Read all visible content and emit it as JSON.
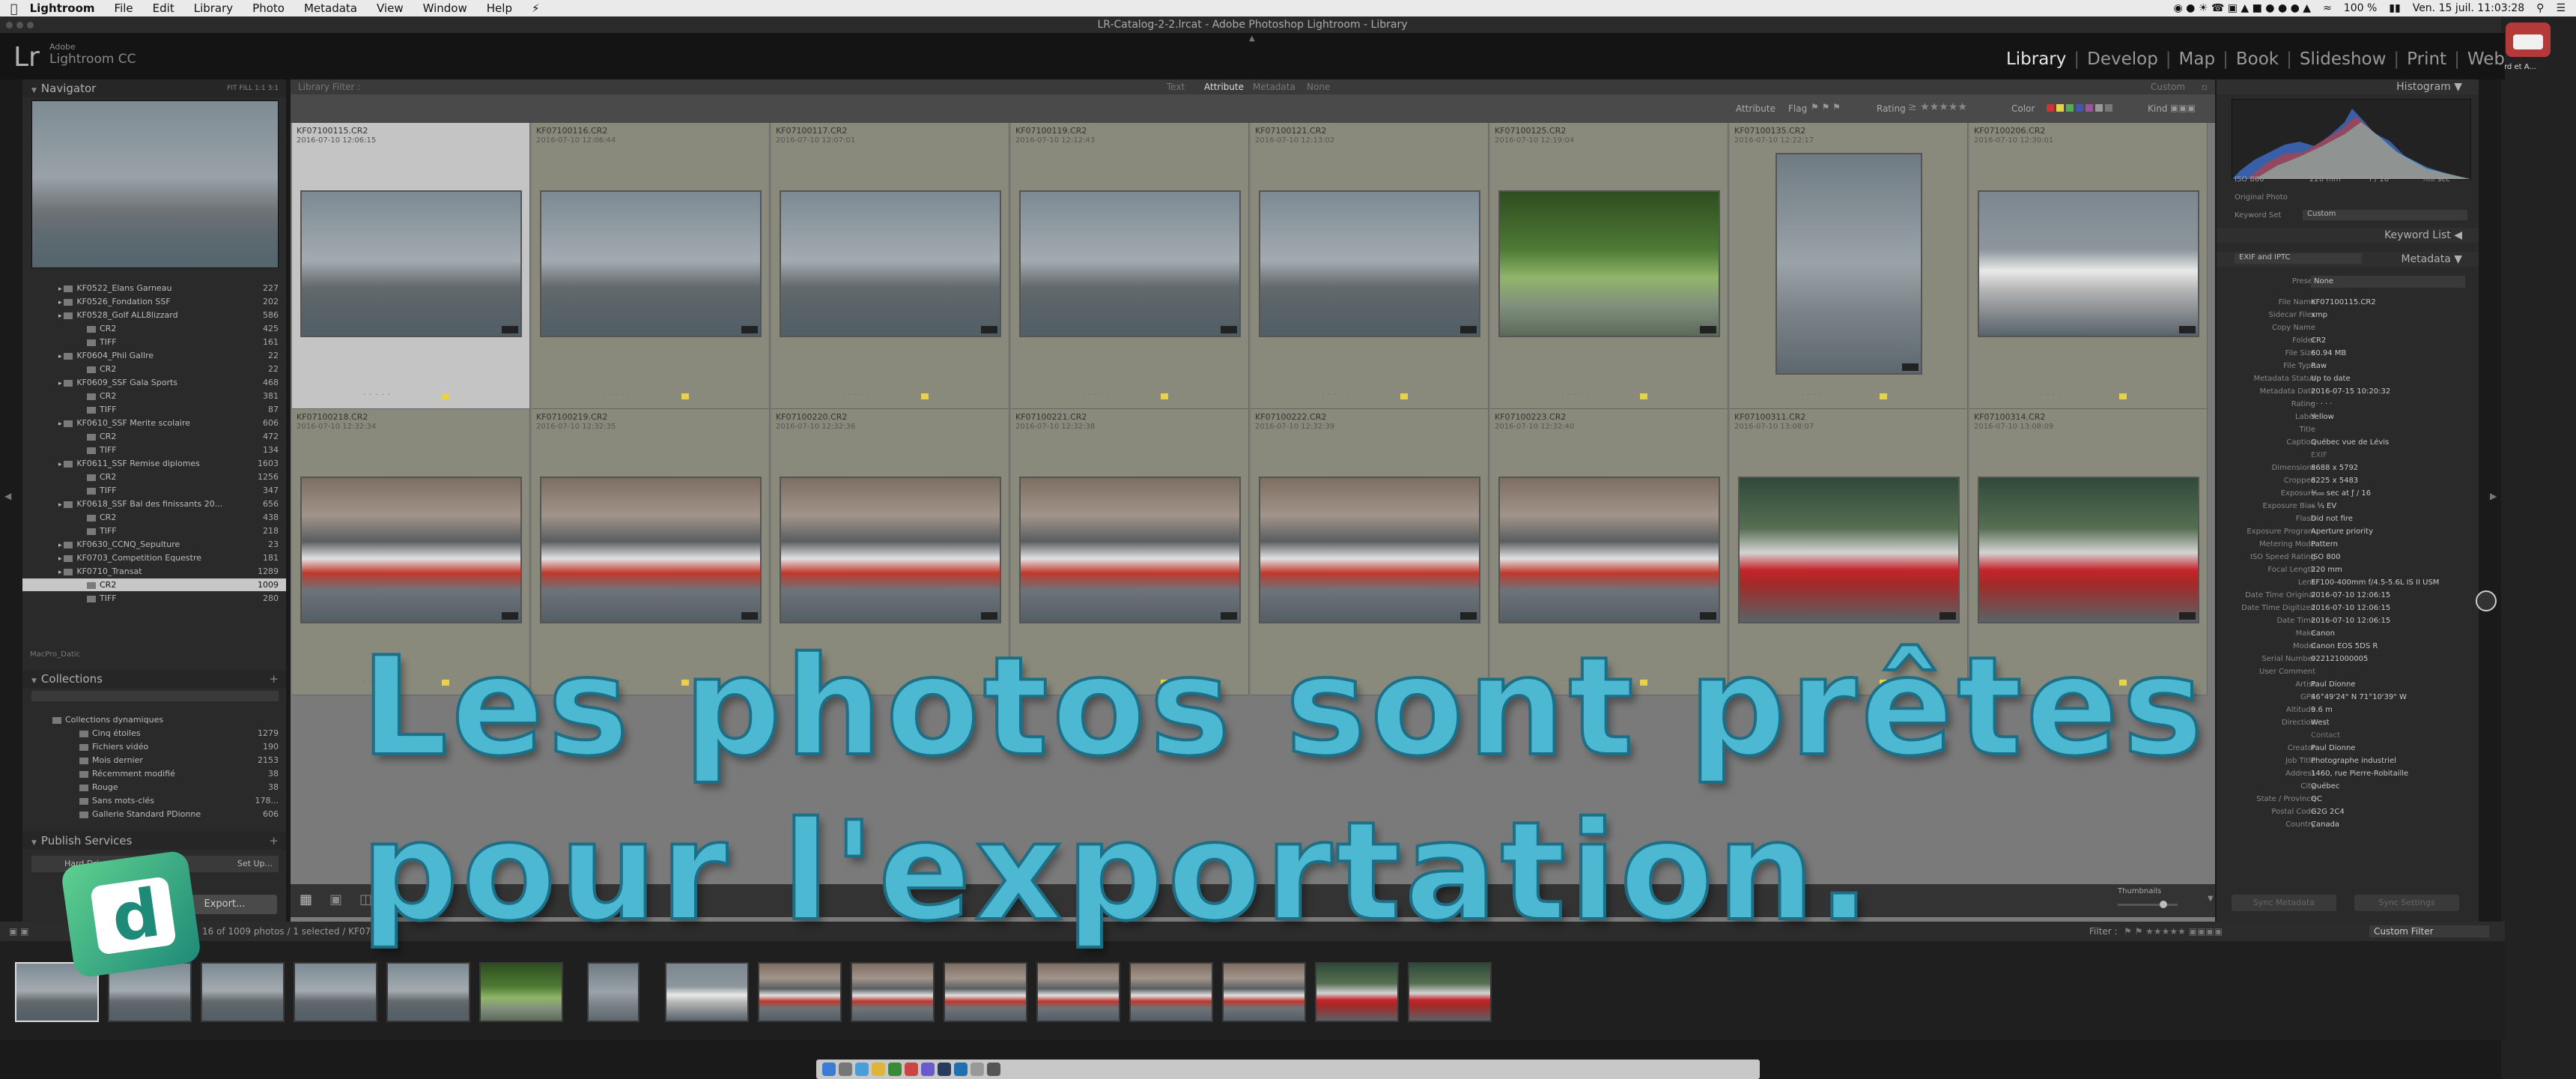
{
  "menubar": {
    "app": "Lightroom",
    "items": [
      "File",
      "Edit",
      "Library",
      "Photo",
      "Metadata",
      "View",
      "Window",
      "Help"
    ],
    "battery": "100 %",
    "clock": "Ven. 15 juil.  11:03:28"
  },
  "window": {
    "title": "LR-Catalog-2-2.lrcat - Adobe Photoshop Lightroom - Library"
  },
  "header": {
    "logo_letters": "Lr",
    "brand_top": "Adobe",
    "brand": "Lightroom CC",
    "modules": [
      "Library",
      "Develop",
      "Map",
      "Book",
      "Slideshow",
      "Print",
      "Web"
    ],
    "active_module": "Library"
  },
  "navigator": {
    "title": "Navigator",
    "zoom": "FIT   FILL   1:1   3:1"
  },
  "folders": [
    {
      "name": "KF0522_Elans Garneau",
      "count": "227",
      "level": 1
    },
    {
      "name": "KF0526_Fondation SSF",
      "count": "202",
      "level": 1
    },
    {
      "name": "KF0528_Golf ALL8lizzard",
      "count": "586",
      "level": 1
    },
    {
      "name": "CR2",
      "count": "425",
      "level": 2
    },
    {
      "name": "TIFF",
      "count": "161",
      "level": 2
    },
    {
      "name": "KF0604_Phil Gallre",
      "count": "22",
      "level": 1
    },
    {
      "name": "CR2",
      "count": "22",
      "level": 2
    },
    {
      "name": "KF0609_SSF Gala Sports",
      "count": "468",
      "level": 1
    },
    {
      "name": "CR2",
      "count": "381",
      "level": 2
    },
    {
      "name": "TIFF",
      "count": "87",
      "level": 2
    },
    {
      "name": "KF0610_SSF Merite scolaire",
      "count": "606",
      "level": 1
    },
    {
      "name": "CR2",
      "count": "472",
      "level": 2
    },
    {
      "name": "TIFF",
      "count": "134",
      "level": 2
    },
    {
      "name": "KF0611_SSF Remise diplomes",
      "count": "1603",
      "level": 1
    },
    {
      "name": "CR2",
      "count": "1256",
      "level": 2
    },
    {
      "name": "TIFF",
      "count": "347",
      "level": 2
    },
    {
      "name": "KF0618_SSF Bal des finissants 20...",
      "count": "656",
      "level": 1
    },
    {
      "name": "CR2",
      "count": "438",
      "level": 2
    },
    {
      "name": "TIFF",
      "count": "218",
      "level": 2
    },
    {
      "name": "KF0630_CCNQ_Sepulture",
      "count": "23",
      "level": 1
    },
    {
      "name": "KF0703_Competition Equestre",
      "count": "181",
      "level": 1
    },
    {
      "name": "KF0710_Transat",
      "count": "1289",
      "level": 1
    },
    {
      "name": "CR2",
      "count": "1009",
      "level": 2,
      "selected": true
    },
    {
      "name": "TIFF",
      "count": "280",
      "level": 2
    }
  ],
  "drive": "MacPro_Datic",
  "collections": {
    "title": "Collections",
    "group": "Collections dynamiques",
    "items": [
      {
        "name": "Cinq étoiles",
        "count": "1279"
      },
      {
        "name": "Fichiers vidéo",
        "count": "190"
      },
      {
        "name": "Mois dernier",
        "count": "2153"
      },
      {
        "name": "Récemment modifié",
        "count": "38"
      },
      {
        "name": "Rouge",
        "count": "38"
      },
      {
        "name": "Sans mots-clés",
        "count": "178..."
      },
      {
        "name": "Gallerie Standard PDionne",
        "count": "606"
      }
    ]
  },
  "publish": {
    "title": "Publish Services",
    "item": "Hard Drive",
    "setup": "Set Up..."
  },
  "buttons": {
    "export": "Export..."
  },
  "filter": {
    "title": "Library Filter :",
    "tabs": [
      "Text",
      "Attribute",
      "Metadata",
      "None"
    ],
    "active_tab": "Attribute",
    "preset": "Custom",
    "attr_label": "Attribute",
    "flag": "Flag",
    "rating": "Rating",
    "color": "Color",
    "kind": "Kind"
  },
  "grid_row1": [
    {
      "file": "KF07100115.CR2",
      "date": "2016-07-10 12:06:15",
      "type": "sky",
      "selected": true
    },
    {
      "file": "KF07100116.CR2",
      "date": "2016-07-10 12:06:44",
      "type": "sky"
    },
    {
      "file": "KF07100117.CR2",
      "date": "2016-07-10 12:07:01",
      "type": "sky"
    },
    {
      "file": "KF07100119.CR2",
      "date": "2016-07-10 12:12:43",
      "type": "sky"
    },
    {
      "file": "KF07100121.CR2",
      "date": "2016-07-10 12:13:02",
      "type": "sky"
    },
    {
      "file": "KF07100125.CR2",
      "date": "2016-07-10 12:19:04",
      "type": "green"
    },
    {
      "file": "KF07100135.CR2",
      "date": "2016-07-10 12:22:17",
      "type": "tower"
    },
    {
      "file": "KF07100206.CR2",
      "date": "2016-07-10 12:30:01",
      "type": "boat"
    }
  ],
  "grid_row2": [
    {
      "file": "KF07100218.CR2",
      "date": "2016-07-10 12:32:34",
      "type": "tug"
    },
    {
      "file": "KF07100219.CR2",
      "date": "2016-07-10 12:32:35",
      "type": "tug"
    },
    {
      "file": "KF07100220.CR2",
      "date": "2016-07-10 12:32:36",
      "type": "tug"
    },
    {
      "file": "KF07100221.CR2",
      "date": "2016-07-10 12:32:38",
      "type": "tug"
    },
    {
      "file": "KF07100222.CR2",
      "date": "2016-07-10 12:32:39",
      "type": "tug"
    },
    {
      "file": "KF07100223.CR2",
      "date": "2016-07-10 12:32:40",
      "type": "tug"
    },
    {
      "file": "KF07100311.CR2",
      "date": "2016-07-10 13:08:07",
      "type": "red"
    },
    {
      "file": "KF07100314.CR2",
      "date": "2016-07-10 13:08:09",
      "type": "red"
    }
  ],
  "histogram": {
    "title": "Histogram",
    "iso": "ISO 800",
    "focal": "220 mm",
    "aperture": "f / 16",
    "shutter": "¹⁄₅₀₀ sec",
    "original": "Original Photo"
  },
  "keyword": {
    "set_label": "Keyword Set",
    "set_value": "Custom",
    "list_title": "Keyword List"
  },
  "metadata": {
    "title": "Metadata",
    "view": "EXIF and IPTC",
    "preset_label": "Preset",
    "preset_value": "None",
    "fields": [
      {
        "k": "File Name",
        "v": "KF07100115.CR2"
      },
      {
        "k": "Sidecar Files",
        "v": "xmp"
      },
      {
        "k": "Copy Name",
        "v": ""
      },
      {
        "k": "Folder",
        "v": "CR2"
      },
      {
        "k": "File Size",
        "v": "60.94 MB"
      },
      {
        "k": "File Type",
        "v": "Raw"
      },
      {
        "k": "Metadata Status",
        "v": "Up to date"
      },
      {
        "k": "Metadata Date",
        "v": "2016-07-15 10:20:32"
      },
      {
        "k": "Rating",
        "v": "·  ·  ·  ·  ·"
      },
      {
        "k": "Label",
        "v": "Yellow"
      },
      {
        "k": "Title",
        "v": ""
      },
      {
        "k": "Caption",
        "v": "Québec vue de Lévis"
      },
      {
        "k": "",
        "v": "EXIF"
      },
      {
        "k": "Dimensions",
        "v": "8688 x 5792"
      },
      {
        "k": "Cropped",
        "v": "8225 x 5483"
      },
      {
        "k": "Exposure",
        "v": "¹⁄₅₀₀ sec at ƒ / 16"
      },
      {
        "k": "Exposure Bias",
        "v": "– ¹⁄₃ EV"
      },
      {
        "k": "Flash",
        "v": "Did not fire"
      },
      {
        "k": "Exposure Program",
        "v": "Aperture priority"
      },
      {
        "k": "Metering Mode",
        "v": "Pattern"
      },
      {
        "k": "ISO Speed Rating",
        "v": "ISO 800"
      },
      {
        "k": "Focal Length",
        "v": "220 mm"
      },
      {
        "k": "Lens",
        "v": "EF100-400mm f/4.5-5.6L IS II USM"
      },
      {
        "k": "Date Time Original",
        "v": "2016-07-10 12:06:15"
      },
      {
        "k": "Date Time Digitized",
        "v": "2016-07-10 12:06:15"
      },
      {
        "k": "Date Time",
        "v": "2016-07-10 12:06:15"
      },
      {
        "k": "Make",
        "v": "Canon"
      },
      {
        "k": "Model",
        "v": "Canon EOS 5DS R"
      },
      {
        "k": "Serial Number",
        "v": "022121000005"
      },
      {
        "k": "User Comment",
        "v": ""
      },
      {
        "k": "Artist",
        "v": "Paul Dionne"
      },
      {
        "k": "GPS",
        "v": "46°49'24\" N 71°10'39\" W"
      },
      {
        "k": "Altitude",
        "v": "9.6 m"
      },
      {
        "k": "Direction",
        "v": "West"
      },
      {
        "k": "",
        "v": "Contact"
      },
      {
        "k": "Creator",
        "v": "Paul Dionne"
      },
      {
        "k": "Job Title",
        "v": "Photographe industriel"
      },
      {
        "k": "Address",
        "v": "1460, rue Pierre-Robitaille"
      },
      {
        "k": "City",
        "v": "Québec"
      },
      {
        "k": "State / Province",
        "v": "QC"
      },
      {
        "k": "Postal Code",
        "v": "G2G 2C4"
      },
      {
        "k": "Country",
        "v": "Canada"
      }
    ],
    "sync_metadata": "Sync Metadata",
    "sync_settings": "Sync Settings"
  },
  "toolbar": {
    "thumbnails": "Thumbnails"
  },
  "filmbar": {
    "status": "16 of 1009 photos / 1 selected / KF0710...",
    "filter_label": "Filter :",
    "filter_value": "Custom Filter"
  },
  "overlay": {
    "line1": "Les photos sont prêtes",
    "line2": "pour l'exportation."
  },
  "colors": {
    "overlay_fill": "#4cb8d1",
    "overlay_stroke": "#1e6f86",
    "label_yellow": "#e6d34a",
    "badge_green": "#34a884"
  }
}
